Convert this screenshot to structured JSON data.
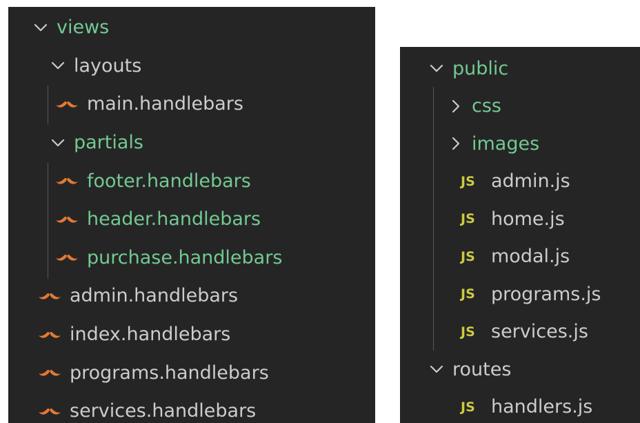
{
  "left_tree": {
    "items": [
      {
        "label": "views",
        "kind": "folder",
        "expanded": true,
        "depth": 0,
        "modified": true
      },
      {
        "label": "layouts",
        "kind": "folder",
        "expanded": true,
        "depth": 1,
        "modified": false
      },
      {
        "label": "main.handlebars",
        "kind": "handlebars",
        "depth": 2,
        "modified": false
      },
      {
        "label": "partials",
        "kind": "folder",
        "expanded": true,
        "depth": 1,
        "modified": true
      },
      {
        "label": "footer.handlebars",
        "kind": "handlebars",
        "depth": 2,
        "modified": true
      },
      {
        "label": "header.handlebars",
        "kind": "handlebars",
        "depth": 2,
        "modified": true
      },
      {
        "label": "purchase.handlebars",
        "kind": "handlebars",
        "depth": 2,
        "modified": true
      },
      {
        "label": "admin.handlebars",
        "kind": "handlebars",
        "depth": 1,
        "modified": false
      },
      {
        "label": "index.handlebars",
        "kind": "handlebars",
        "depth": 1,
        "modified": false
      },
      {
        "label": "programs.handlebars",
        "kind": "handlebars",
        "depth": 1,
        "modified": false
      },
      {
        "label": "services.handlebars",
        "kind": "handlebars",
        "depth": 1,
        "modified": false
      }
    ]
  },
  "right_tree": {
    "items": [
      {
        "label": "public",
        "kind": "folder",
        "expanded": true,
        "depth": 0,
        "modified": true
      },
      {
        "label": "css",
        "kind": "folder",
        "expanded": false,
        "depth": 1,
        "modified": true
      },
      {
        "label": "images",
        "kind": "folder",
        "expanded": false,
        "depth": 1,
        "modified": true
      },
      {
        "label": "admin.js",
        "kind": "js",
        "depth": 1,
        "modified": false
      },
      {
        "label": "home.js",
        "kind": "js",
        "depth": 1,
        "modified": false
      },
      {
        "label": "modal.js",
        "kind": "js",
        "depth": 1,
        "modified": false
      },
      {
        "label": "programs.js",
        "kind": "js",
        "depth": 1,
        "modified": false
      },
      {
        "label": "services.js",
        "kind": "js",
        "depth": 1,
        "modified": false
      },
      {
        "label": "routes",
        "kind": "folder",
        "expanded": true,
        "depth": 0,
        "modified": false
      },
      {
        "label": "handlers.js",
        "kind": "js",
        "depth": 1,
        "modified": false
      }
    ]
  },
  "icons": {
    "handlebars": "handlebars-mustache-icon",
    "js": "javascript-file-icon",
    "expanded": "chevron-down-icon",
    "collapsed": "chevron-right-icon",
    "js_badge_text": "JS"
  },
  "colors": {
    "panel_bg": "#252526",
    "text": "#cccccc",
    "modified_text": "#73c991",
    "handlebars_icon": "#e37933",
    "js_icon": "#cbcb41",
    "indent_guide": "#585858",
    "page_bg": "#ffffff"
  }
}
